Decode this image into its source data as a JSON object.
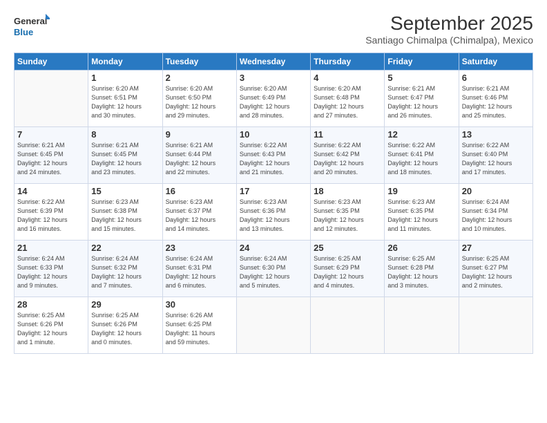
{
  "logo": {
    "line1": "General",
    "line2": "Blue"
  },
  "title": "September 2025",
  "subtitle": "Santiago Chimalpa (Chimalpa), Mexico",
  "weekdays": [
    "Sunday",
    "Monday",
    "Tuesday",
    "Wednesday",
    "Thursday",
    "Friday",
    "Saturday"
  ],
  "weeks": [
    [
      {
        "day": "",
        "info": ""
      },
      {
        "day": "1",
        "info": "Sunrise: 6:20 AM\nSunset: 6:51 PM\nDaylight: 12 hours\nand 30 minutes."
      },
      {
        "day": "2",
        "info": "Sunrise: 6:20 AM\nSunset: 6:50 PM\nDaylight: 12 hours\nand 29 minutes."
      },
      {
        "day": "3",
        "info": "Sunrise: 6:20 AM\nSunset: 6:49 PM\nDaylight: 12 hours\nand 28 minutes."
      },
      {
        "day": "4",
        "info": "Sunrise: 6:20 AM\nSunset: 6:48 PM\nDaylight: 12 hours\nand 27 minutes."
      },
      {
        "day": "5",
        "info": "Sunrise: 6:21 AM\nSunset: 6:47 PM\nDaylight: 12 hours\nand 26 minutes."
      },
      {
        "day": "6",
        "info": "Sunrise: 6:21 AM\nSunset: 6:46 PM\nDaylight: 12 hours\nand 25 minutes."
      }
    ],
    [
      {
        "day": "7",
        "info": "Sunrise: 6:21 AM\nSunset: 6:45 PM\nDaylight: 12 hours\nand 24 minutes."
      },
      {
        "day": "8",
        "info": "Sunrise: 6:21 AM\nSunset: 6:45 PM\nDaylight: 12 hours\nand 23 minutes."
      },
      {
        "day": "9",
        "info": "Sunrise: 6:21 AM\nSunset: 6:44 PM\nDaylight: 12 hours\nand 22 minutes."
      },
      {
        "day": "10",
        "info": "Sunrise: 6:22 AM\nSunset: 6:43 PM\nDaylight: 12 hours\nand 21 minutes."
      },
      {
        "day": "11",
        "info": "Sunrise: 6:22 AM\nSunset: 6:42 PM\nDaylight: 12 hours\nand 20 minutes."
      },
      {
        "day": "12",
        "info": "Sunrise: 6:22 AM\nSunset: 6:41 PM\nDaylight: 12 hours\nand 18 minutes."
      },
      {
        "day": "13",
        "info": "Sunrise: 6:22 AM\nSunset: 6:40 PM\nDaylight: 12 hours\nand 17 minutes."
      }
    ],
    [
      {
        "day": "14",
        "info": "Sunrise: 6:22 AM\nSunset: 6:39 PM\nDaylight: 12 hours\nand 16 minutes."
      },
      {
        "day": "15",
        "info": "Sunrise: 6:23 AM\nSunset: 6:38 PM\nDaylight: 12 hours\nand 15 minutes."
      },
      {
        "day": "16",
        "info": "Sunrise: 6:23 AM\nSunset: 6:37 PM\nDaylight: 12 hours\nand 14 minutes."
      },
      {
        "day": "17",
        "info": "Sunrise: 6:23 AM\nSunset: 6:36 PM\nDaylight: 12 hours\nand 13 minutes."
      },
      {
        "day": "18",
        "info": "Sunrise: 6:23 AM\nSunset: 6:35 PM\nDaylight: 12 hours\nand 12 minutes."
      },
      {
        "day": "19",
        "info": "Sunrise: 6:23 AM\nSunset: 6:35 PM\nDaylight: 12 hours\nand 11 minutes."
      },
      {
        "day": "20",
        "info": "Sunrise: 6:24 AM\nSunset: 6:34 PM\nDaylight: 12 hours\nand 10 minutes."
      }
    ],
    [
      {
        "day": "21",
        "info": "Sunrise: 6:24 AM\nSunset: 6:33 PM\nDaylight: 12 hours\nand 9 minutes."
      },
      {
        "day": "22",
        "info": "Sunrise: 6:24 AM\nSunset: 6:32 PM\nDaylight: 12 hours\nand 7 minutes."
      },
      {
        "day": "23",
        "info": "Sunrise: 6:24 AM\nSunset: 6:31 PM\nDaylight: 12 hours\nand 6 minutes."
      },
      {
        "day": "24",
        "info": "Sunrise: 6:24 AM\nSunset: 6:30 PM\nDaylight: 12 hours\nand 5 minutes."
      },
      {
        "day": "25",
        "info": "Sunrise: 6:25 AM\nSunset: 6:29 PM\nDaylight: 12 hours\nand 4 minutes."
      },
      {
        "day": "26",
        "info": "Sunrise: 6:25 AM\nSunset: 6:28 PM\nDaylight: 12 hours\nand 3 minutes."
      },
      {
        "day": "27",
        "info": "Sunrise: 6:25 AM\nSunset: 6:27 PM\nDaylight: 12 hours\nand 2 minutes."
      }
    ],
    [
      {
        "day": "28",
        "info": "Sunrise: 6:25 AM\nSunset: 6:26 PM\nDaylight: 12 hours\nand 1 minute."
      },
      {
        "day": "29",
        "info": "Sunrise: 6:25 AM\nSunset: 6:26 PM\nDaylight: 12 hours\nand 0 minutes."
      },
      {
        "day": "30",
        "info": "Sunrise: 6:26 AM\nSunset: 6:25 PM\nDaylight: 11 hours\nand 59 minutes."
      },
      {
        "day": "",
        "info": ""
      },
      {
        "day": "",
        "info": ""
      },
      {
        "day": "",
        "info": ""
      },
      {
        "day": "",
        "info": ""
      }
    ]
  ]
}
